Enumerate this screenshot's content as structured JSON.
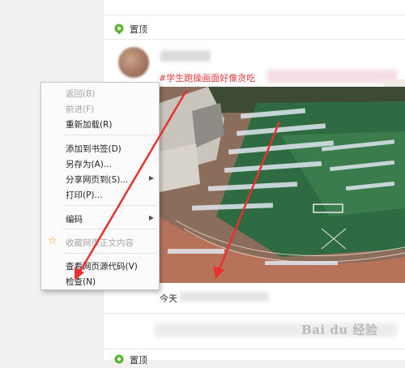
{
  "feed": {
    "section1_title": "置顶",
    "section2_title": "置顶",
    "post": {
      "hashtag": "#学生跑操画面好像贪吃",
      "caption": "今天"
    }
  },
  "watermark": "Bai du 经验",
  "context_menu": {
    "items": [
      {
        "label": "返回(B)",
        "enabled": false
      },
      {
        "label": "前进(F)",
        "enabled": false
      },
      {
        "label": "重新加载(R)",
        "enabled": true
      },
      {
        "label": "添加到书签(D)",
        "enabled": true
      },
      {
        "label": "另存为(A)...",
        "enabled": true
      },
      {
        "label": "分享网页到(S)...",
        "enabled": true,
        "submenu": true
      },
      {
        "label": "打印(P)...",
        "enabled": true
      },
      {
        "label": "编码",
        "enabled": true,
        "submenu": true
      },
      {
        "label": "收藏网页正文内容",
        "enabled": false,
        "icon": "star-icon"
      },
      {
        "label": "查看网页源代码(V)",
        "enabled": true
      },
      {
        "label": "检查(N)",
        "enabled": true
      }
    ]
  },
  "colors": {
    "accent_red": "#e8322f",
    "hashtag_red": "#e03b3b",
    "pin_green": "#5cb531",
    "star_orange": "#f0a500"
  }
}
